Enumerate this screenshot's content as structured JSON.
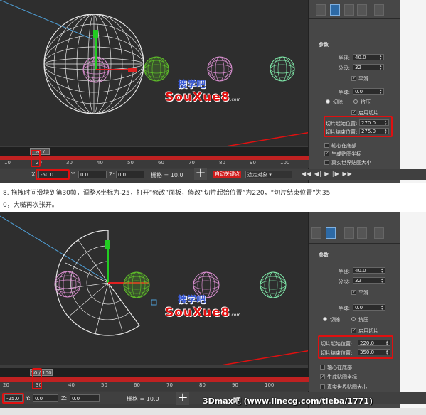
{
  "screenshot1": {
    "sidebar": {
      "section_title": "参数",
      "radius_label": "半径:",
      "radius_value": "40.0",
      "segments_label": "分段:",
      "segments_value": "32",
      "smooth_label": "平滑",
      "hemisphere_label": "半球:",
      "hemisphere_value": "0.0",
      "chop_label": "切除",
      "squash_label": "挤压",
      "enable_slice_label": "启用切片",
      "slice_from_label": "切片起始位置:",
      "slice_from_value": "270.0",
      "slice_to_label": "切片结束位置:",
      "slice_to_value": "275.0",
      "base_to_pivot_label": "轴心在底部",
      "gen_mapping_label": "生成贴图坐标",
      "real_world_label": "真实世界贴图大小"
    },
    "timeline": {
      "frame_value": "20",
      "frame_total": "100"
    },
    "ruler": [
      "10",
      "20",
      "30",
      "40",
      "50",
      "60",
      "70",
      "80",
      "90",
      "100"
    ],
    "status": {
      "x_label": "X:",
      "x_value": "-50.0",
      "y_label": "Y:",
      "y_value": "0.0",
      "z_label": "Z:",
      "z_value": "0.0",
      "grid_label": "栅格 = 10.0",
      "autokey_label": "自动关键点",
      "selected_label": "选定对象"
    }
  },
  "instruction": {
    "line1": "8. 拖拽时间滑块到第30帧，调整X坐标为-25，打开“修改”面板，修改“切片起始位置”为220，“切片结束位置”为35",
    "line2": "0，大嘴再次张开。"
  },
  "screenshot2": {
    "sidebar": {
      "section_title": "参数",
      "radius_label": "半径:",
      "radius_value": "40.0",
      "segments_label": "分段:",
      "segments_value": "32",
      "smooth_label": "平滑",
      "hemisphere_label": "半球:",
      "hemisphere_value": "0.0",
      "chop_label": "切除",
      "squash_label": "挤压",
      "enable_slice_label": "启用切片",
      "slice_from_label": "切片起始位置:",
      "slice_from_value": "220.0",
      "slice_to_label": "切片结束位置:",
      "slice_to_value": "350.0",
      "base_to_pivot_label": "轴心在底部",
      "gen_mapping_label": "生成贴图坐标",
      "real_world_label": "真实世界贴图大小"
    },
    "timeline": {
      "frame_value": "30",
      "frame_total": "100"
    },
    "ruler": [
      "20",
      "30",
      "40",
      "50",
      "60",
      "70",
      "80",
      "90",
      "100"
    ],
    "status": {
      "x_label": "X:",
      "x_value": "-25.0",
      "y_label": "Y:",
      "y_value": "0.0",
      "z_label": "Z:",
      "z_value": "0.0",
      "grid_label": "栅格 = 10.0"
    }
  },
  "logo": {
    "top": "搜学吧",
    "main": "SouXue8",
    "com": ".com"
  },
  "watermark": "3Dmax吧 (www.linecg.com/tieba/1771)",
  "colors": {
    "highlight": "#e01010",
    "pac_white": "#e8e8e8",
    "sphere_green": "#5fbf2a",
    "sphere_pink": "#d98fd0",
    "sphere_mint": "#7fe6a8"
  }
}
